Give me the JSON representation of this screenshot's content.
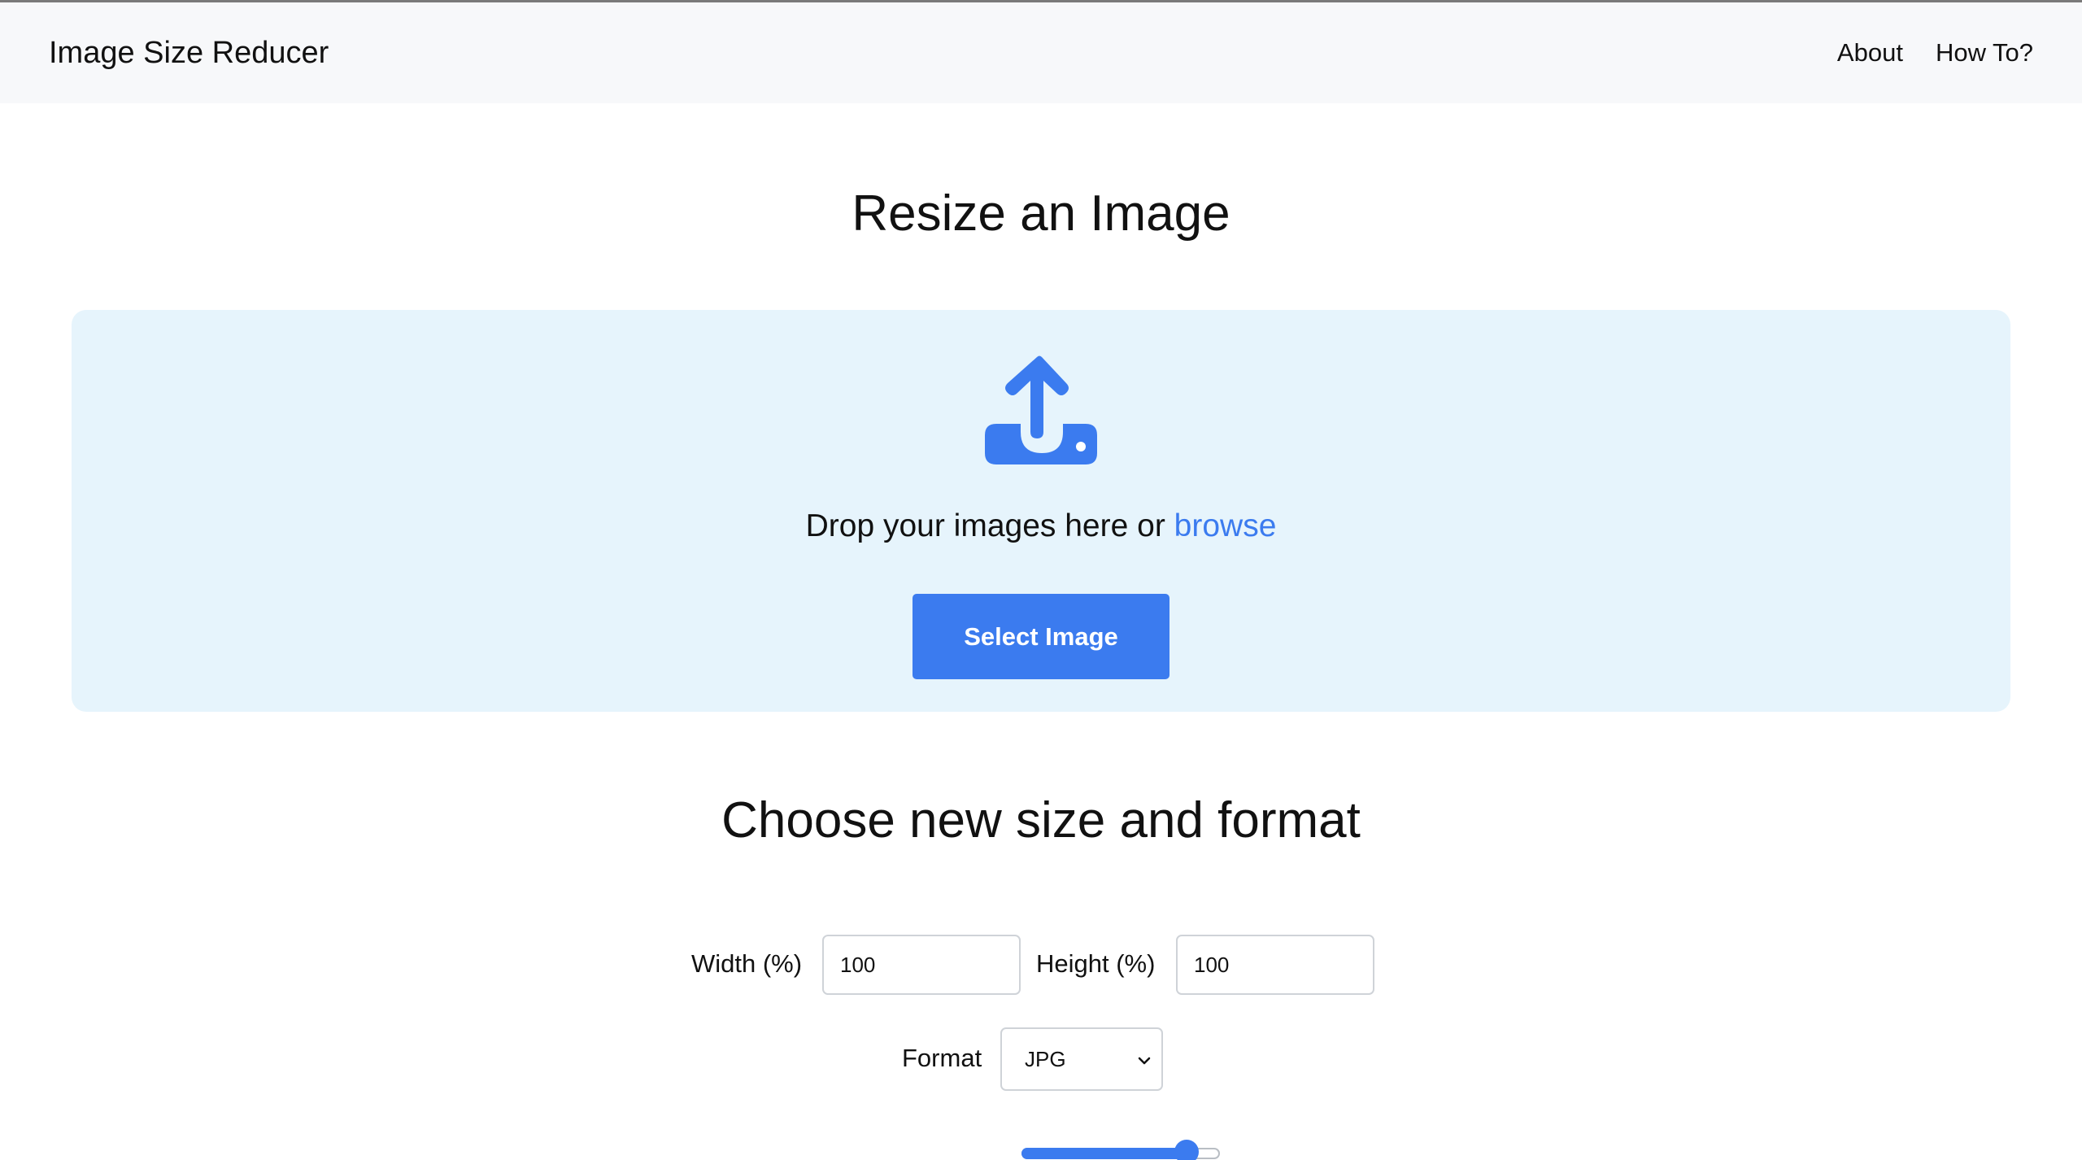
{
  "header": {
    "brand": "Image Size Reducer",
    "nav": [
      {
        "label": "About"
      },
      {
        "label": "How To?"
      }
    ]
  },
  "upload": {
    "title": "Resize an Image",
    "icon": "upload-icon",
    "drop_text": "Drop your images here or ",
    "browse_label": "browse",
    "select_button": "Select Image"
  },
  "options": {
    "title": "Choose new size and format",
    "width_label": "Width (%)",
    "width_value": "100",
    "height_label": "Height (%)",
    "height_value": "100",
    "format_label": "Format",
    "format_value": "JPG",
    "quality_slider_fraction": 0.88
  },
  "colors": {
    "accent": "#3b7bef",
    "dropzone_bg": "#e6f4fc",
    "navbar_bg": "#f7f8fa"
  }
}
